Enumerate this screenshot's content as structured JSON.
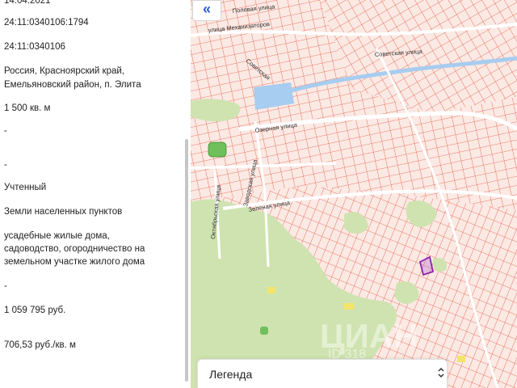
{
  "panel": {
    "date": "14.04.2021",
    "cadastral_number": "24:11:0340106:1794",
    "cadastral_quarter": "24:11:0340106",
    "address_line1": "Россия, Красноярский край,",
    "address_line2": "Емельяновский район, п. Элита",
    "area": "1 500 кв. м",
    "dash1": "-",
    "dash2": "-",
    "status": "Учтенный",
    "land_category": "Земли населенных пунктов",
    "permitted_use_line1": "усадебные жилые дома,",
    "permitted_use_line2": "садоводство, огородничество на",
    "permitted_use_line3": "земельном участке жилого дома",
    "dash3": "-",
    "cadastral_value": "1 059 795 руб.",
    "price_per_meter": "706,53 руб./кв. м"
  },
  "map": {
    "collapse_icon": "double-chevron-left-icon",
    "collapse_glyph": "«",
    "streets": {
      "poleva": "Полевая улица",
      "mechanizatorov": "улица Механизаторов",
      "sovetskaya": "Советская улица",
      "sovetskaya_short": "Советская",
      "ozernaya": "Озерная улица",
      "zelenaya": "Зеленая улица",
      "zavodskaya": "Заводская улица",
      "oktyabrskaya": "Октябрьская улица"
    },
    "watermark": "ЦИАН",
    "watermark_id": "ID 318"
  },
  "legend": {
    "label": "Легенда",
    "chevron_icon": "chevron-up-down-icon",
    "chevron_glyph": "⌃⌄"
  },
  "colors": {
    "parcel_line": "#e8553a",
    "parcel_fill": "#fbe9e4",
    "green": "#cfe3b0",
    "water": "#a7cdf0",
    "accent": "#2a5bd7",
    "selected": "#8e24aa"
  }
}
